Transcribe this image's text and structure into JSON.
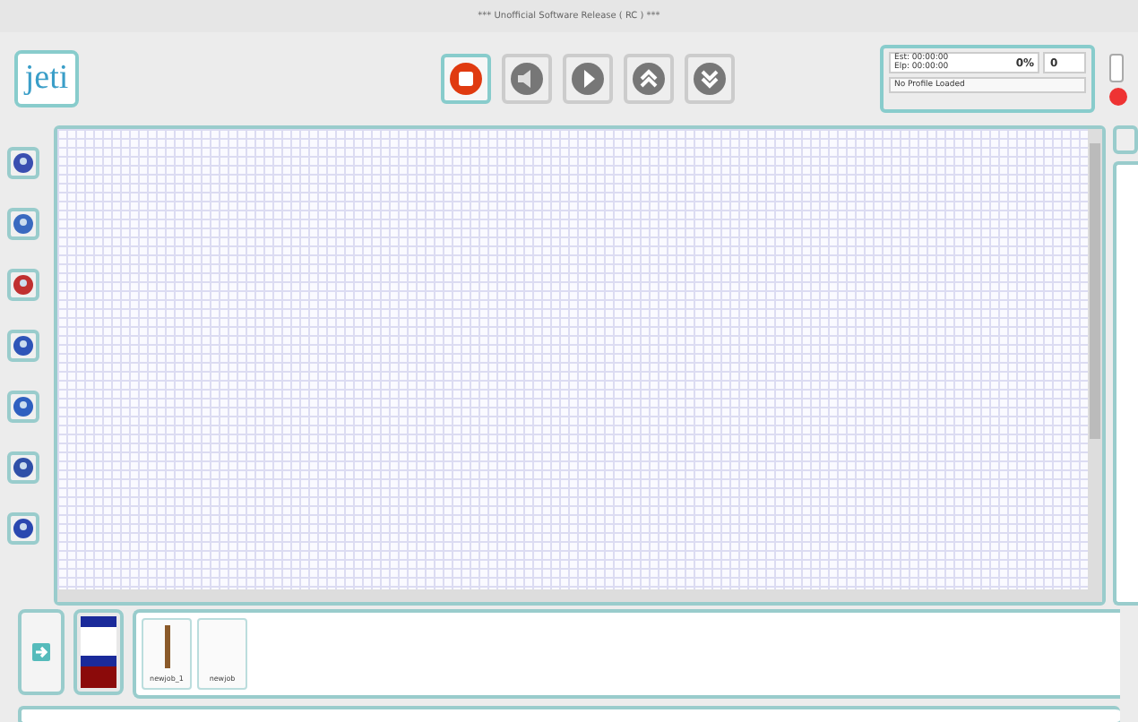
{
  "window": {
    "title": "*** Unofficial Software Release ( RC ) ***"
  },
  "logo": {
    "text": "jeti"
  },
  "toolbar": {
    "buttons": [
      {
        "kind": "stop",
        "selected": true
      },
      {
        "kind": "sound",
        "selected": false
      },
      {
        "kind": "play",
        "selected": false
      },
      {
        "kind": "up",
        "selected": false
      },
      {
        "kind": "down",
        "selected": false
      }
    ]
  },
  "job_status": {
    "estimated": "Est:  00:00:00",
    "elapsed": "Elp:  00:00:00",
    "progress": "0%",
    "copies": "0",
    "profile": "No Profile Loaded"
  },
  "side_tools": [
    {
      "kind": "a"
    },
    {
      "kind": "b"
    },
    {
      "kind": "c"
    },
    {
      "kind": "d"
    },
    {
      "kind": "e"
    },
    {
      "kind": "f"
    },
    {
      "kind": "g"
    }
  ],
  "jobs": [
    {
      "name": "newjob_1",
      "kind": "bar"
    },
    {
      "name": "newjob",
      "kind": "blank"
    }
  ]
}
